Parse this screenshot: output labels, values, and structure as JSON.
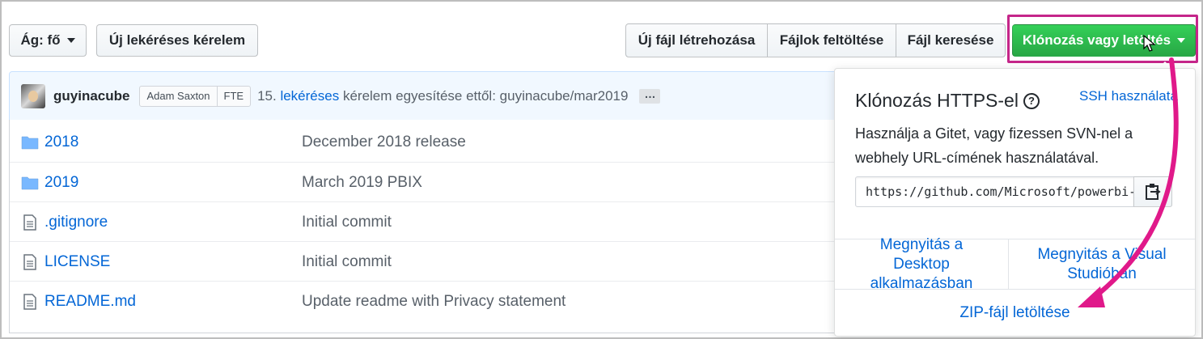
{
  "toolbar": {
    "branch_label": "Ág: fő",
    "new_pull_request": "Új lekéréses kérelem",
    "create_file": "Új fájl létrehozása",
    "upload_files": "Fájlok feltöltése",
    "find_file": "Fájl keresése",
    "clone_download": "Klónozás vagy letöltés"
  },
  "commit": {
    "author": "guyinacube",
    "coauthor": "Adam Saxton",
    "coauthor_tag": "FTE",
    "message_prefix": "15.",
    "message_link": "lekéréses",
    "message_suffix": "kérelem egyesítése ettől: guyinacube/mar2019",
    "ellipsis": "…"
  },
  "files": [
    {
      "name": "2018",
      "type": "folder",
      "message": "December 2018 release"
    },
    {
      "name": "2019",
      "type": "folder",
      "message": "March 2019 PBIX"
    },
    {
      "name": ".gitignore",
      "type": "file",
      "message": "Initial commit"
    },
    {
      "name": "LICENSE",
      "type": "file",
      "message": "Initial commit"
    },
    {
      "name": "README.md",
      "type": "file",
      "message": "Update readme with Privacy statement"
    }
  ],
  "clone_panel": {
    "title": "Klónozás HTTPS-el",
    "help_glyph": "?",
    "ssh_link": "SSH használata",
    "description": "Használja a Gitet, vagy fizessen SVN-nel a webhely URL-címének használatával.",
    "url": "https://github.com/Microsoft/powerbi-desktop-samples.git",
    "open_desktop": "Megnyitás a Desktop alkalmazásban",
    "open_vs": "Megnyitás a Visual Studióban",
    "download_zip": "ZIP-fájl letöltése"
  },
  "colors": {
    "accent_green": "#28a745",
    "link_blue": "#0366d6",
    "annotation_magenta": "#e0198a"
  }
}
